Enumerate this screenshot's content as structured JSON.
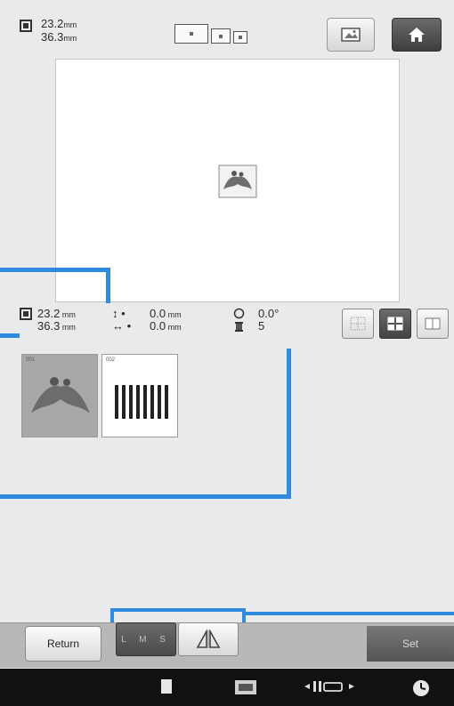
{
  "top": {
    "width": "23.2",
    "height": "36.3",
    "unit": "mm"
  },
  "info": {
    "width": "23.2",
    "height": "36.3",
    "unit": "mm",
    "v_arrow": "↕ •",
    "h_arrow": "↔ •",
    "v_offset": "0.0",
    "h_offset": "0.0",
    "offset_unit": "mm",
    "angle": "0.0°",
    "colors": "5"
  },
  "thumbs": [
    {
      "num": "001"
    },
    {
      "num": "002"
    }
  ],
  "bottom": {
    "return_label": "Return",
    "lms_label": "L M S",
    "set_label": "Set"
  },
  "colors": {
    "accent_blue": "#2f8ae0",
    "screen_bg": "#e9eaec",
    "dark_button": "#4a4a4a"
  },
  "icons": {
    "size": "pattern-size-icon",
    "image": "image-view-icon",
    "home": "home-icon",
    "rotate": "rotate-icon",
    "spool": "thread-color-icon",
    "mirror": "mirror-icon",
    "grid": "grid-icon",
    "status": [
      "page-icon",
      "bobbin-icon",
      "needle-mode-icon",
      "clock-icon"
    ]
  }
}
